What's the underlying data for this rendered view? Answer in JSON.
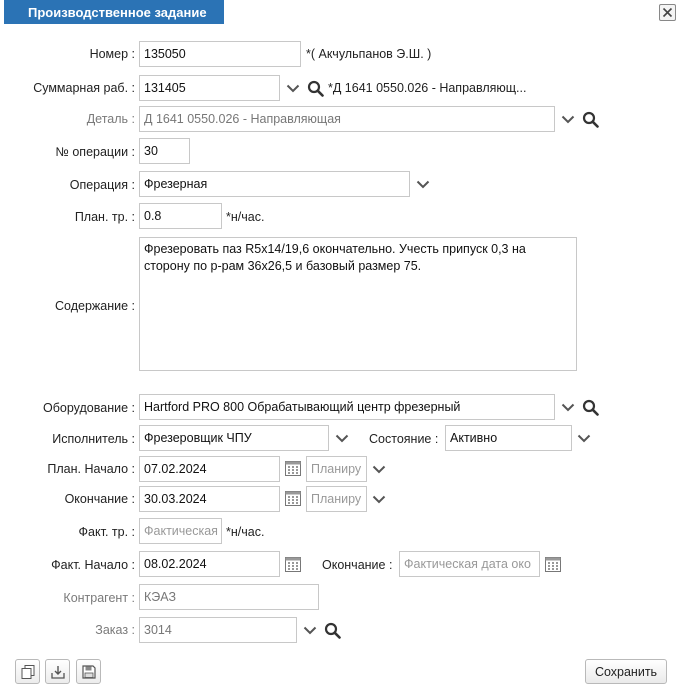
{
  "window": {
    "title": "Производственное задание"
  },
  "form": {
    "nomer": {
      "label": "Номер :",
      "value": "135050",
      "author": "*( Акчульпанов Э.Ш. )"
    },
    "summ": {
      "label": "Суммарная раб. :",
      "value": "131405",
      "desc": "*Д 1641 0550.026 - Направляющ..."
    },
    "detal": {
      "label": "Деталь :",
      "value": "Д 1641 0550.026 - Направляющая"
    },
    "op_num": {
      "label": "№ операции :",
      "value": "30"
    },
    "operation": {
      "label": "Операция :",
      "value": "Фрезерная"
    },
    "plan_tr": {
      "label": "План. тр. :",
      "value": "0.8",
      "unit": "*н/час."
    },
    "content": {
      "label": "Содержание :",
      "value": "Фрезеровать паз R5x14/19,6 окончательно. Учесть припуск 0,3 на\nсторону по р-рам 36x26,5 и базовый размер 75."
    },
    "equipment": {
      "label": "Оборудование :",
      "value": "Hartford PRO 800 Обрабатывающий центр фрезерный"
    },
    "executor": {
      "label": "Исполнитель :",
      "value": "Фрезеровщик ЧПУ"
    },
    "state": {
      "label": "Состояние :",
      "value": "Активно"
    },
    "plan_start": {
      "label": "План. Начало :",
      "value": "07.02.2024",
      "plan_placeholder": "Планиру"
    },
    "end": {
      "label": "Окончание :",
      "value": "30.03.2024",
      "plan_placeholder": "Планиру"
    },
    "fact_tr": {
      "label": "Факт. тр. :",
      "placeholder": "Фактическая",
      "unit": "*н/час."
    },
    "fact_start": {
      "label": "Факт. Начало :",
      "value": "08.02.2024"
    },
    "fact_end": {
      "label": "Окончание :",
      "placeholder": "Фактическая дата око"
    },
    "contractor": {
      "label": "Контрагент :",
      "value": "КЭАЗ"
    },
    "order": {
      "label": "Заказ :",
      "value": "3014"
    }
  },
  "footer": {
    "save_label": "Сохранить"
  },
  "icons": {
    "dropdown": "chevron-down-icon",
    "search": "search-icon",
    "calendar": "calendar-icon",
    "close": "close-icon",
    "copy": "copy-icon",
    "download": "download-icon",
    "save": "floppy-icon"
  }
}
